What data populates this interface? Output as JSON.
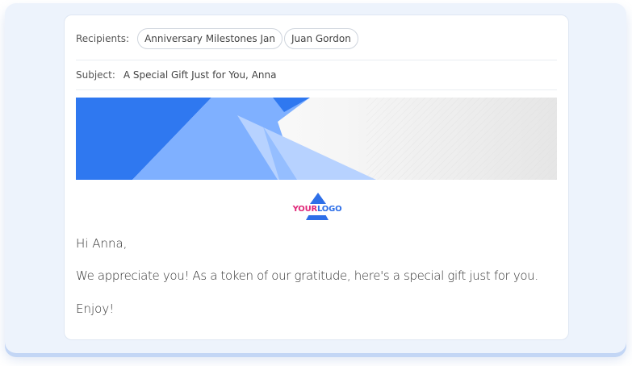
{
  "email": {
    "recipients_label": "Recipients:",
    "recipients": [
      "Anniversary Milestones Jan",
      "Juan Gordon"
    ],
    "subject_label": "Subject:",
    "subject": "A Special Gift Just for You, Anna"
  },
  "logo": {
    "part1": "YOUR",
    "part2": "LOGO"
  },
  "message": {
    "greeting": "Hi Anna,",
    "body": "We appreciate you! As a token of our gratitude, here's a special gift just for you.",
    "closing": "Enjoy!"
  },
  "colors": {
    "accent": "#2e6fe8",
    "logo_pink": "#e02778",
    "panel_bg": "#edf3fc"
  }
}
